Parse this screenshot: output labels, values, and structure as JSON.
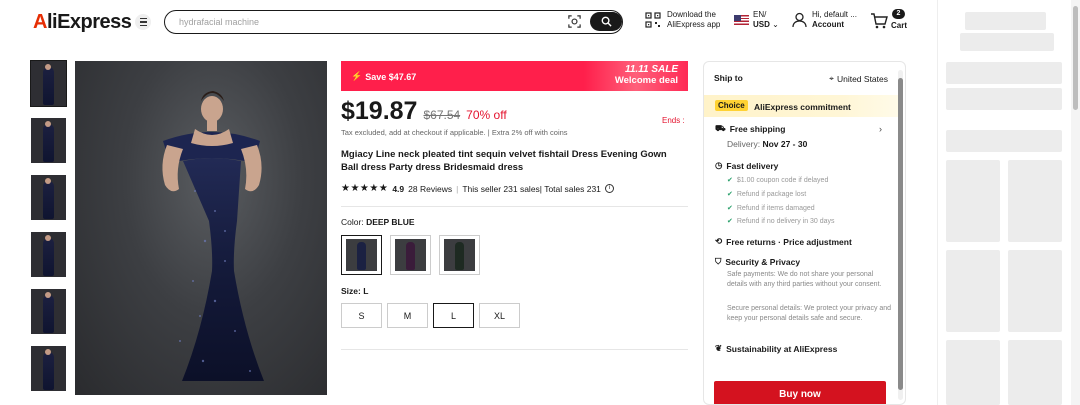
{
  "header": {
    "logo": "AliExpress",
    "search_placeholder": "hydrafacial machine",
    "app_line1": "Download the",
    "app_line2": "AliExpress app",
    "lang": "EN/",
    "currency": "USD",
    "account_line1": "Hi, default ...",
    "account_line2": "Account",
    "cart_count": "2",
    "cart_label": "Cart"
  },
  "promo": {
    "save": "Save $47.67",
    "sale_line1": "11.11 SALE",
    "sale_line2": "Welcome deal"
  },
  "price": {
    "current": "$19.87",
    "original": "$67.54",
    "discount": "70% off",
    "ends": "Ends :",
    "tax_note": "Tax excluded, add at checkout if applicable.",
    "coins_note": "Extra 2% off with coins"
  },
  "product": {
    "title": "Mgiacy Line neck pleated tint sequin velvet fishtail Dress Evening Gown Ball dress Party dress Bridesmaid dress",
    "rating": "4.9",
    "reviews": "28 Reviews",
    "sales": "This seller 231 sales| Total sales 231",
    "color_label": "Color:",
    "color_value": "DEEP BLUE",
    "size_label": "Size:",
    "size_value": "L",
    "sizes": [
      "S",
      "M",
      "L",
      "XL"
    ],
    "swatch_colors": [
      "#1b2142",
      "#3a1c3a",
      "#1e2a22"
    ]
  },
  "panel": {
    "ship_to_label": "Ship to",
    "ship_to_value": "United States",
    "choice": "Choice",
    "commitment": "AliExpress commitment",
    "free_shipping": "Free shipping",
    "delivery_label": "Delivery:",
    "delivery_dates": "Nov 27 - 30",
    "fast_delivery": "Fast delivery",
    "fast_items": [
      "$1.00 coupon code if delayed",
      "Refund if package lost",
      "Refund if items damaged",
      "Refund if no delivery in 30 days"
    ],
    "free_returns": "Free returns · Price adjustment",
    "security": "Security & Privacy",
    "security_p1": "Safe payments: We do not share your personal details with any third parties without your consent.",
    "security_p2": "Secure personal details: We protect your privacy and keep your personal details safe and secure.",
    "sustainability": "Sustainability at AliExpress",
    "buy_now": "Buy now"
  },
  "colors": {
    "accent_red": "#e4132e",
    "promo_pink": "#ff1f4b",
    "buy_red": "#d4121f",
    "choice_yellow": "#ffd233"
  }
}
